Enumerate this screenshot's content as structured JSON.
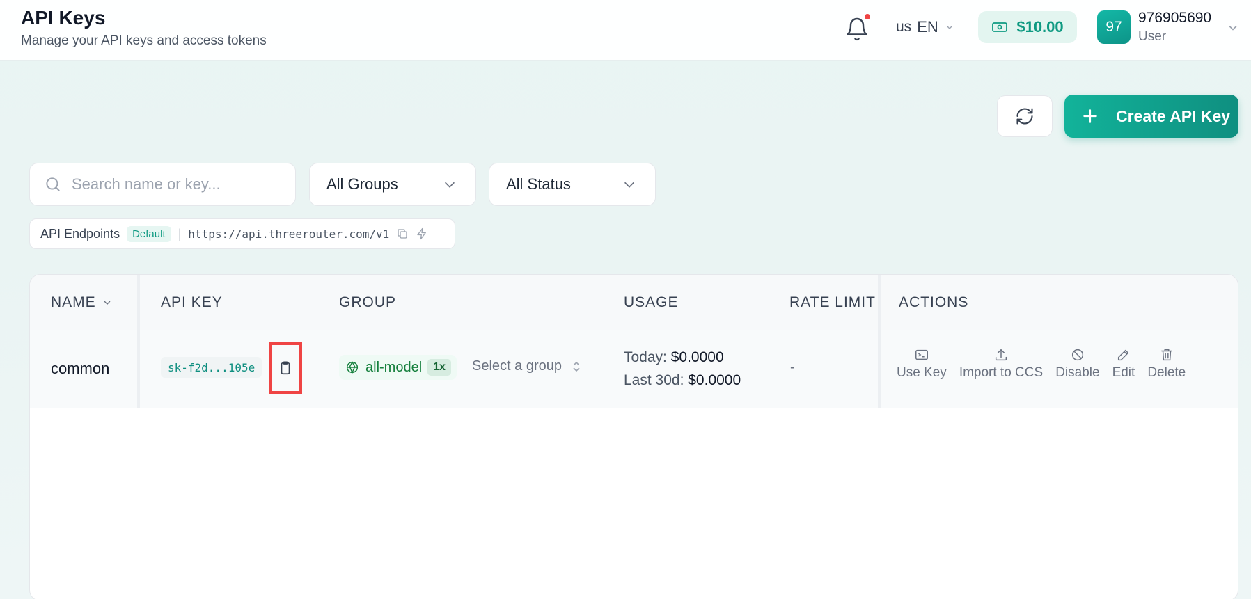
{
  "header": {
    "title": "API Keys",
    "subtitle": "Manage your API keys and access tokens",
    "language": {
      "flag": "us",
      "code": "EN"
    },
    "balance": "$10.00",
    "user": {
      "avatar_initials": "97",
      "id": "976905690",
      "role": "User"
    }
  },
  "toolbar": {
    "create_label": "Create API Key"
  },
  "filters": {
    "search_placeholder": "Search name or key...",
    "group_selected": "All Groups",
    "status_selected": "All Status"
  },
  "endpoints": {
    "label": "API Endpoints",
    "badge": "Default",
    "url": "https://api.threerouter.com/v1"
  },
  "table": {
    "columns": [
      "NAME",
      "API KEY",
      "GROUP",
      "USAGE",
      "RATE LIMIT",
      "ACTIONS"
    ],
    "rows": [
      {
        "name": "common",
        "key": "sk-f2d...105e",
        "group": "all-model",
        "multiplier": "1x",
        "group_select_placeholder": "Select a group",
        "usage_today_label": "Today:",
        "usage_today": "$0.0000",
        "usage_30d_label": "Last 30d:",
        "usage_30d": "$0.0000",
        "rate_limit": "-",
        "actions": [
          "Use Key",
          "Import to CCS",
          "Disable",
          "Edit",
          "Delete"
        ]
      }
    ]
  },
  "colors": {
    "accent": "#0f9a82",
    "highlight": "#ef4444"
  }
}
